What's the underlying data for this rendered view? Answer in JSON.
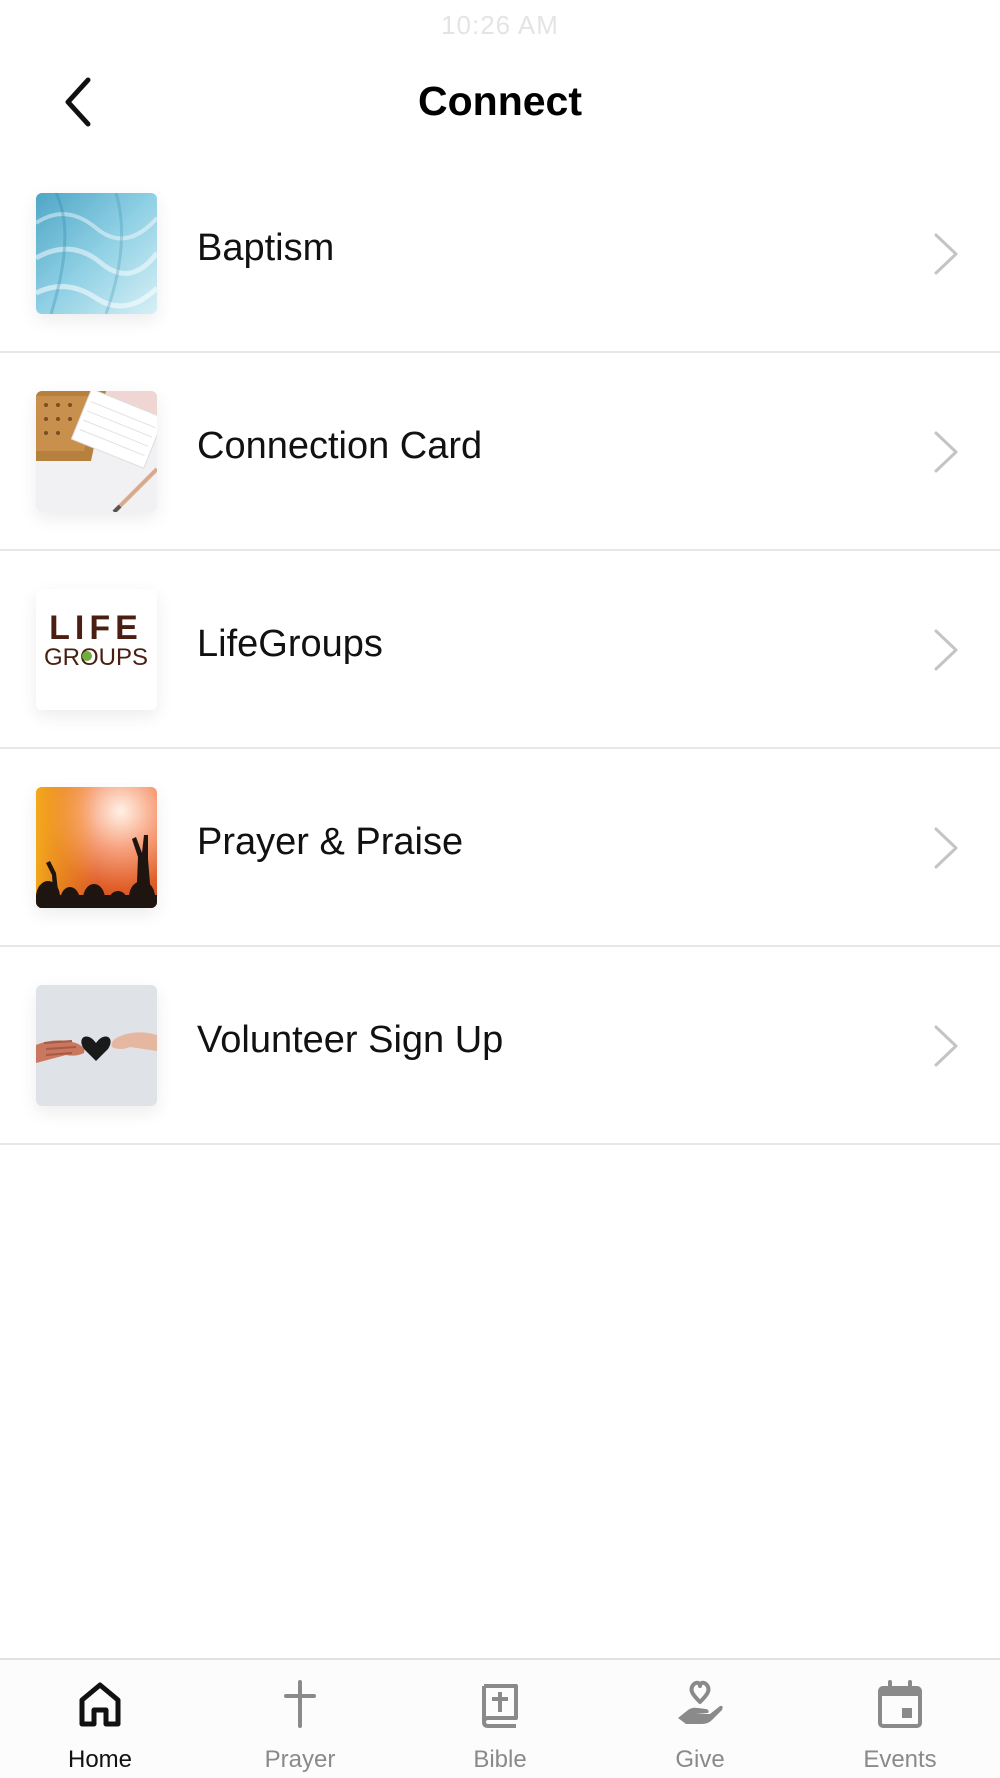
{
  "status_bar": {
    "time": "10:26 AM"
  },
  "header": {
    "title": "Connect"
  },
  "list": {
    "items": [
      {
        "label": "Baptism"
      },
      {
        "label": "Connection Card"
      },
      {
        "label": "LifeGroups",
        "thumb_text_top": "LIFE",
        "thumb_text_bottom": "GROUPS"
      },
      {
        "label": "Prayer & Praise"
      },
      {
        "label": "Volunteer Sign Up"
      }
    ]
  },
  "tab_bar": {
    "tabs": [
      {
        "label": "Home",
        "icon": "home-icon",
        "active": true
      },
      {
        "label": "Prayer",
        "icon": "cross-icon",
        "active": false
      },
      {
        "label": "Bible",
        "icon": "bible-icon",
        "active": false
      },
      {
        "label": "Give",
        "icon": "give-icon",
        "active": false
      },
      {
        "label": "Events",
        "icon": "calendar-icon",
        "active": false
      }
    ]
  },
  "colors": {
    "active_tab": "#111111",
    "inactive_tab": "#8a8a8a",
    "divider": "#e7e7e7"
  }
}
